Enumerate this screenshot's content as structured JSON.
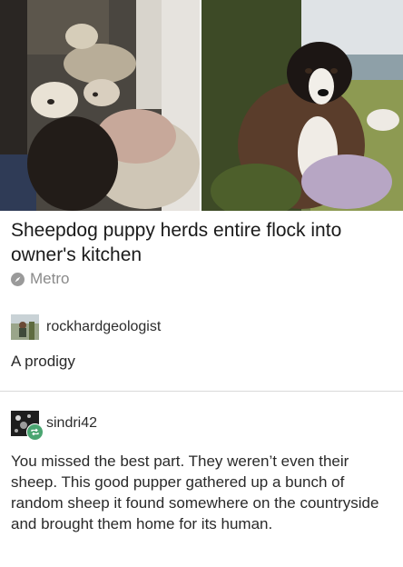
{
  "images": {
    "left_icon": "sheep-in-kitchen-photo",
    "right_icon": "sheepdog-puppy-photo"
  },
  "article": {
    "headline": "Sheepdog puppy herds entire flock into owner's kitchen",
    "source": "Metro",
    "source_icon": "compass-icon"
  },
  "posts": [
    {
      "username": "rockhardgeologist",
      "text": "A prodigy"
    },
    {
      "username": "sindri42",
      "text": "You missed the best part. They weren’t even their sheep. This good pupper gathered up a bunch of random sheep it found somewhere on the countryside and brought them home for its human.",
      "badge_icon": "reblog-icon"
    }
  ],
  "colors": {
    "reblog_badge": "#4aa571",
    "divider": "#d9d9d9"
  }
}
